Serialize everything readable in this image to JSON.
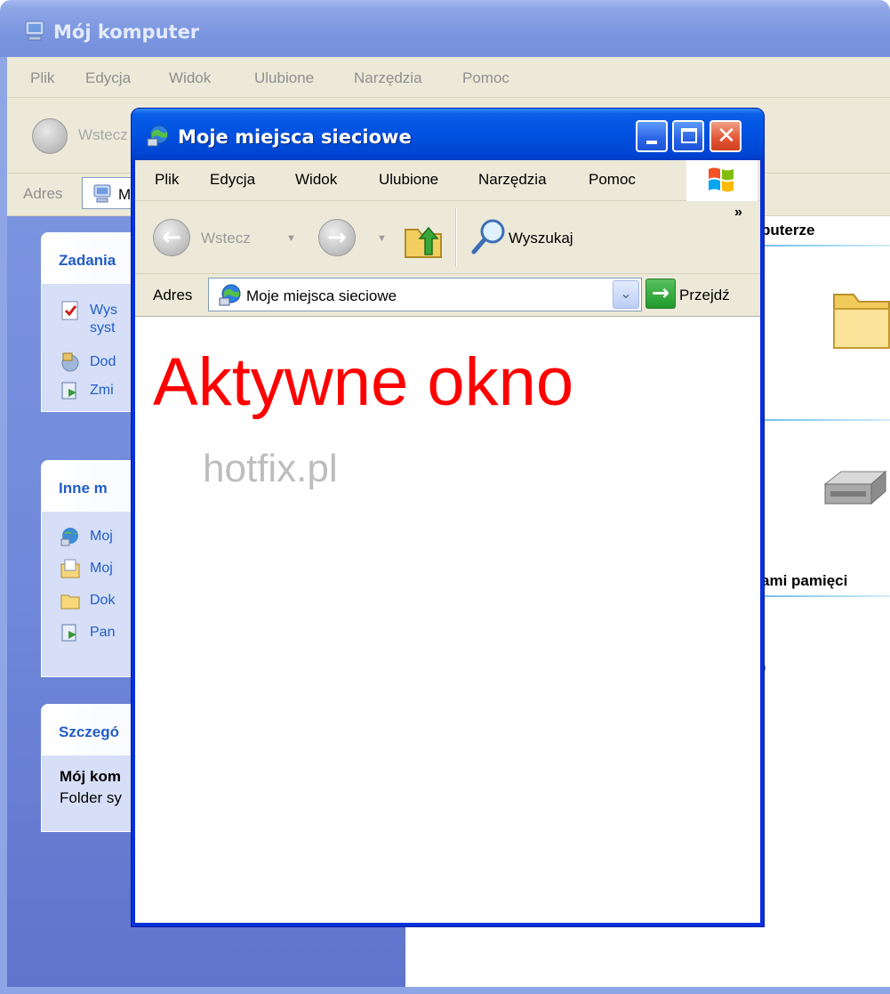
{
  "back_window": {
    "title": "Mój komputer",
    "menu": [
      "Plik",
      "Edycja",
      "Widok",
      "Ulubione",
      "Narzędzia",
      "Pomoc"
    ],
    "toolbar": {
      "back_label": "Wstecz"
    },
    "address": {
      "label": "Adres",
      "value": "M"
    },
    "sidebar": {
      "tasks_header": "Zadania",
      "tasks": [
        {
          "label": "Wys",
          "label_line2": "syst",
          "icon": "system-info-icon"
        },
        {
          "label": "Dod",
          "icon": "add-remove-programs-icon"
        },
        {
          "label": "Zmi",
          "icon": "control-panel-icon"
        }
      ],
      "places_header": "Inne m",
      "places": [
        {
          "label": "Moj",
          "icon": "network-places-icon"
        },
        {
          "label": "Moj",
          "icon": "my-documents-icon"
        },
        {
          "label": "Dok",
          "icon": "folder-icon"
        },
        {
          "label": "Pan",
          "icon": "control-panel-icon"
        }
      ],
      "details_header": "Szczegó",
      "details_title": "Mój kom",
      "details_sub": "Folder sy"
    },
    "content": {
      "group1_header": "puterze",
      "group2_header": "ami pamięci",
      "stray_text": ")"
    }
  },
  "front_window": {
    "title": "Moje miejsca sieciowe",
    "menu": [
      "Plik",
      "Edycja",
      "Widok",
      "Ulubione",
      "Narzędzia",
      "Pomoc"
    ],
    "toolbar": {
      "back_label": "Wstecz",
      "search_label": "Wyszukaj",
      "more": "»"
    },
    "address": {
      "label": "Adres",
      "value": "Moje miejsca sieciowe",
      "go_label": "Przejdź"
    },
    "overlay": {
      "title": "Aktywne okno",
      "subtitle": "hotfix.pl"
    }
  },
  "colors": {
    "active_title_blue": "#0054e3",
    "inactive_title_blue": "#8ea6e6",
    "overlay_red": "#ff0000",
    "overlay_gray": "#bdbdbd",
    "xp_gray": "#ece9d8"
  }
}
